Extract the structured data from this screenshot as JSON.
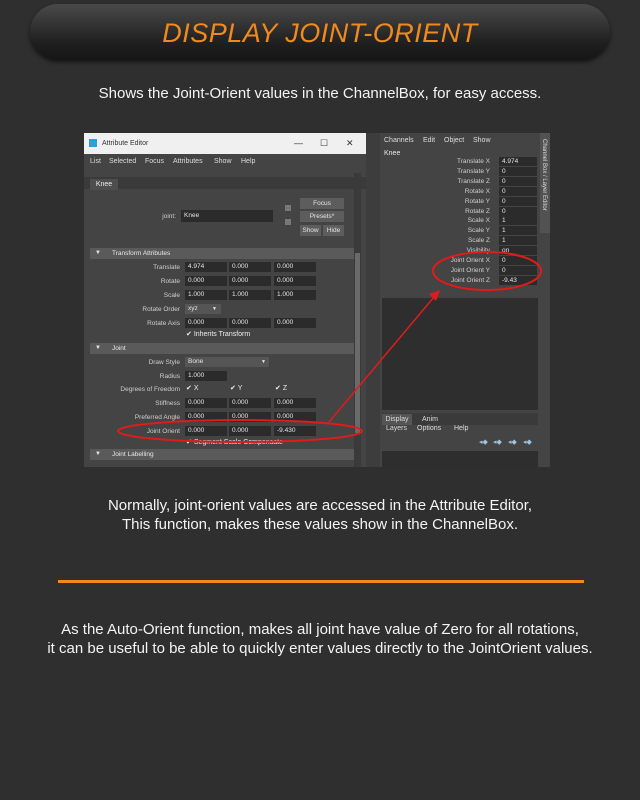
{
  "header": {
    "title": "DISPLAY JOINT-ORIENT"
  },
  "intro": "Shows the Joint-Orient values in the ChannelBox, for easy access.",
  "note": {
    "line1": "Normally, joint-orient values are accessed in the Attribute Editor,",
    "line2": "This function, makes these values show in the ChannelBox."
  },
  "footer": {
    "line1": "As the Auto-Orient function, makes all joint have value of Zero for all rotations,",
    "line2": "it can be useful to be able to quickly enter values directly to the JointOrient values."
  },
  "colors": {
    "accent": "#f08a1c",
    "highlight_red": "#e01b1b"
  },
  "attribute_editor": {
    "title": "Attribute Editor",
    "menus": [
      "List",
      "Selected",
      "Focus",
      "Attributes",
      "Show",
      "Help"
    ],
    "tab": "Knee",
    "joint_label": "joint:",
    "joint_value": "Knee",
    "focus_btn": "Focus",
    "presets_btn": "Presets*",
    "show_btn": "Show",
    "hide_btn": "Hide",
    "transform_section": "Transform Attributes",
    "translate": {
      "label": "Translate",
      "x": "4.974",
      "y": "0.000",
      "z": "0.000"
    },
    "rotate": {
      "label": "Rotate",
      "x": "0.000",
      "y": "0.000",
      "z": "0.000"
    },
    "scale": {
      "label": "Scale",
      "x": "1.000",
      "y": "1.000",
      "z": "1.000"
    },
    "rotate_order": {
      "label": "Rotate Order",
      "value": "xyz"
    },
    "rotate_axis": {
      "label": "Rotate Axis",
      "x": "0.000",
      "y": "0.000",
      "z": "0.000"
    },
    "inherits_transform": "Inherits Transform",
    "joint_section": "Joint",
    "draw_style": {
      "label": "Draw Style",
      "value": "Bone"
    },
    "radius": {
      "label": "Radius",
      "value": "1.000"
    },
    "dof": {
      "label": "Degrees of Freedom",
      "x": "X",
      "y": "Y",
      "z": "Z"
    },
    "stiffness": {
      "label": "Stiffness",
      "x": "0.000",
      "y": "0.000",
      "z": "0.000"
    },
    "preferred_angle": {
      "label": "Preferred Angle",
      "x": "0.000",
      "y": "0.000",
      "z": "0.000"
    },
    "joint_orient": {
      "label": "Joint Orient",
      "x": "0.000",
      "y": "0.000",
      "z": "-9.430"
    },
    "segment_scale": "Segment Scale Compensate",
    "labelling_section": "Joint Labelling"
  },
  "channel_box": {
    "menus": [
      "Channels",
      "Edit",
      "Object",
      "Show"
    ],
    "side_tab": "Channel Box / Layer Editor",
    "node": "Knee",
    "channels": [
      {
        "label": "Translate X",
        "value": "4.974"
      },
      {
        "label": "Translate Y",
        "value": "0"
      },
      {
        "label": "Translate Z",
        "value": "0"
      },
      {
        "label": "Rotate X",
        "value": "0"
      },
      {
        "label": "Rotate Y",
        "value": "0"
      },
      {
        "label": "Rotate Z",
        "value": "0"
      },
      {
        "label": "Scale X",
        "value": "1"
      },
      {
        "label": "Scale Y",
        "value": "1"
      },
      {
        "label": "Scale Z",
        "value": "1"
      },
      {
        "label": "Visibility",
        "value": "on"
      },
      {
        "label": "Joint Orient X",
        "value": "0"
      },
      {
        "label": "Joint Orient Y",
        "value": "0"
      },
      {
        "label": "Joint Orient Z",
        "value": "-9.43"
      }
    ],
    "display_tab": "Display",
    "anim_tab": "Anim",
    "layer_menus": [
      "Layers",
      "Options",
      "Help"
    ]
  }
}
